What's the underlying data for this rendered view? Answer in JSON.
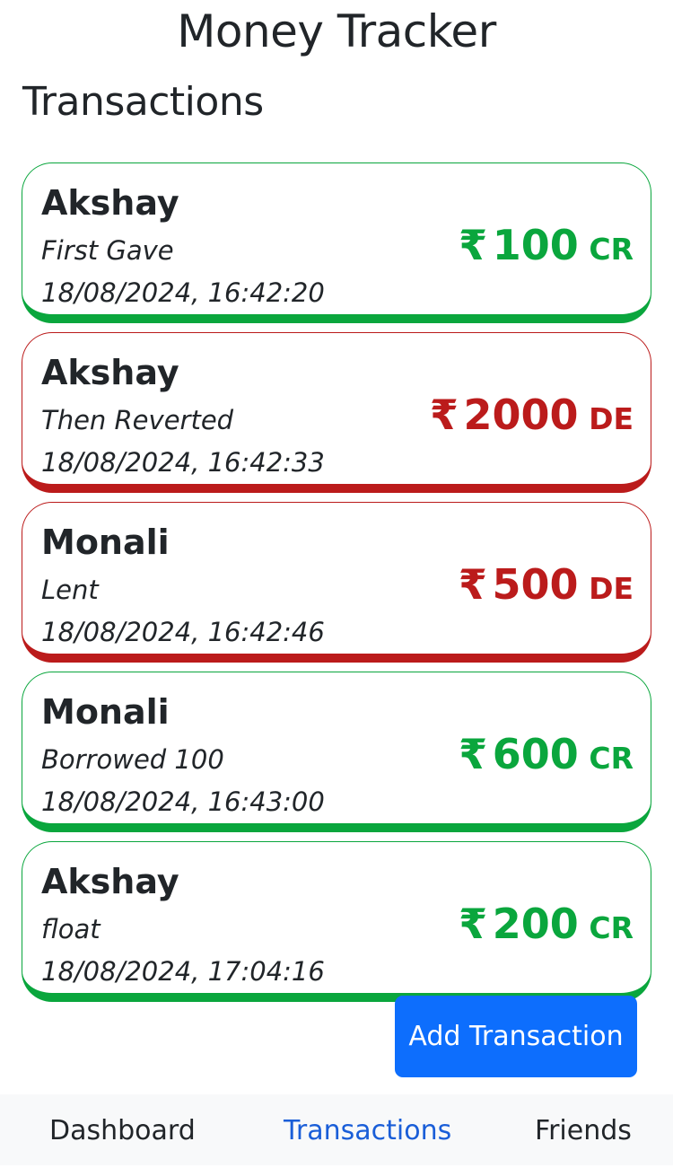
{
  "app": {
    "title": "Money Tracker"
  },
  "page": {
    "heading": "Transactions"
  },
  "colors": {
    "credit": "#0aa63d",
    "debit": "#bb1b1b",
    "primary_button": "#0d6efd",
    "nav_active": "#1a5ed8",
    "nav_background": "#f8f9fa"
  },
  "transactions": [
    {
      "name": "Akshay",
      "note": "First Gave",
      "datetime": "18/08/2024, 16:42:20",
      "currency": "₹",
      "amount": "100",
      "type": "CR"
    },
    {
      "name": "Akshay",
      "note": "Then Reverted",
      "datetime": "18/08/2024, 16:42:33",
      "currency": "₹",
      "amount": "2000",
      "type": "DE"
    },
    {
      "name": "Monali",
      "note": "Lent",
      "datetime": "18/08/2024, 16:42:46",
      "currency": "₹",
      "amount": "500",
      "type": "DE"
    },
    {
      "name": "Monali",
      "note": "Borrowed 100",
      "datetime": "18/08/2024, 16:43:00",
      "currency": "₹",
      "amount": "600",
      "type": "CR"
    },
    {
      "name": "Akshay",
      "note": "float",
      "datetime": "18/08/2024, 17:04:16",
      "currency": "₹",
      "amount": "200",
      "type": "CR"
    }
  ],
  "actions": {
    "add_transaction": "Add Transaction"
  },
  "nav": {
    "items": [
      {
        "label": "Dashboard",
        "active": false
      },
      {
        "label": "Transactions",
        "active": true
      },
      {
        "label": "Friends",
        "active": false
      }
    ]
  }
}
